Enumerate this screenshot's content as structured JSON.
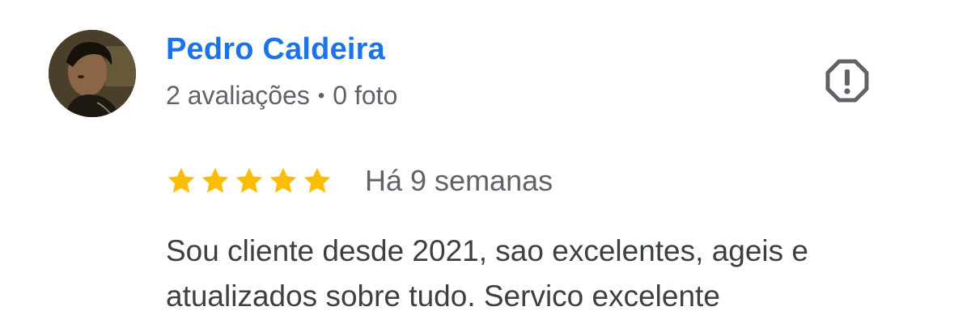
{
  "review": {
    "author": {
      "name": "Pedro Caldeira",
      "reviews_count": "2 avaliações",
      "separator": "•",
      "photos_count": "0 foto",
      "avatar_icon": "user-photo-avatar"
    },
    "report_icon": "report-flag-icon",
    "rating": {
      "stars": 5,
      "max_stars": 5,
      "star_color": "#fbbc04"
    },
    "date": "Há 9 semanas",
    "text": "Sou cliente desde 2021, sao excelentes, ageis e atualizados sobre tudo. Servico excelente"
  },
  "colors": {
    "name": "#1a73e8",
    "meta": "#5f6368",
    "body": "#3c4043",
    "icon": "#5f6368"
  }
}
